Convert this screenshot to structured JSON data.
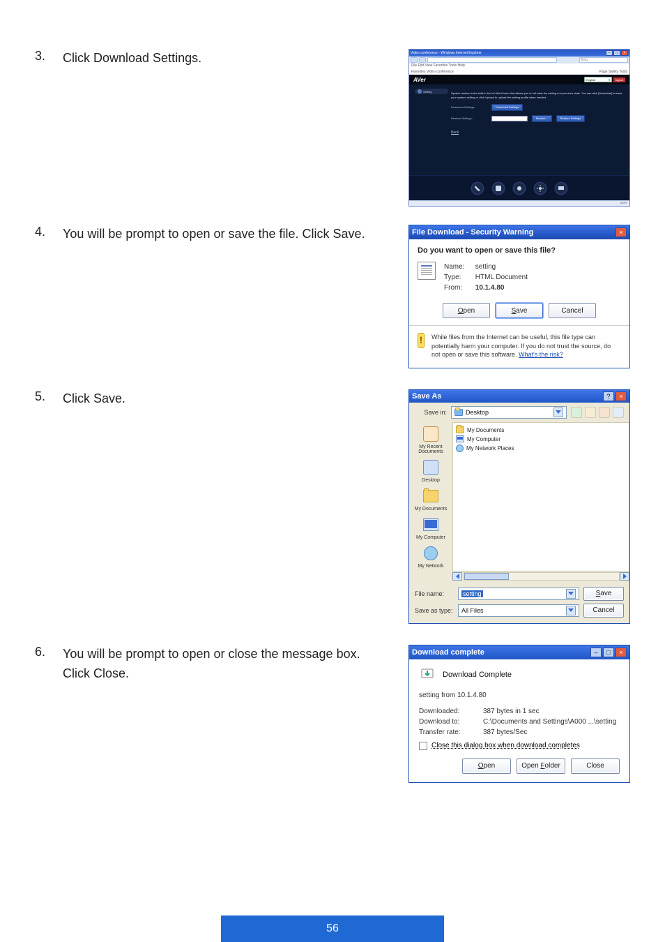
{
  "page_number": "56",
  "steps": {
    "s3": {
      "num": "3.",
      "text": "Click Download Settings."
    },
    "s4": {
      "num": "4.",
      "text": "You will be prompt to open or save the file. Click Save."
    },
    "s5": {
      "num": "5.",
      "text": "Click Save."
    },
    "s6": {
      "num": "6.",
      "text": "You will be prompt to open or close the message box. Click Close."
    }
  },
  "shot1": {
    "window_title": "Video conference - Windows Internet Explorer",
    "address": "10.1.4.80",
    "search_placeholder": "Bing",
    "menu": "File  Edit  View  Favorites  Tools  Help",
    "fav_left": "Favorites   Video conference",
    "fav_right": "Page  Safety  Tools",
    "brand": "AVer",
    "lang": "English",
    "logout": "logout",
    "side_item": "Setting",
    "desc": "System restore is the built-in tool of AVerComm that allows you to roll back the setting to a previous state. You can click [Download] to save your system setting or click Upload to upload the setting profile when needed.",
    "row1_label": "Download Settings:",
    "row1_btn": "Download Settings",
    "row2_label": "Restore Settings:",
    "row2_btn1": "Browse...",
    "row2_btn2": "Restore Settings",
    "back": "Back",
    "status_zoom": "100%"
  },
  "shot2": {
    "title": "File Download - Security Warning",
    "question": "Do you want to open or save this file?",
    "name_k": "Name:",
    "name_v": "setting",
    "type_k": "Type:",
    "type_v": "HTML Document",
    "from_k": "From:",
    "from_v": "10.1.4.80",
    "btn_open": "Open",
    "btn_save": "Save",
    "btn_cancel": "Cancel",
    "warn": "While files from the Internet can be useful, this file type can potentially harm your computer. If you do not trust the source, do not open or save this software. ",
    "warn_link": "What's the risk?"
  },
  "shot3": {
    "title": "Save As",
    "savein_label": "Save in:",
    "savein_value": "Desktop",
    "places": {
      "recent": "My Recent Documents",
      "desktop": "Desktop",
      "docs": "My Documents",
      "comp": "My Computer",
      "net": "My Network"
    },
    "list": {
      "i1": "My Documents",
      "i2": "My Computer",
      "i3": "My Network Places"
    },
    "filename_label": "File name:",
    "filename_value": "setting",
    "type_label": "Save as type:",
    "type_value": "All Files",
    "btn_save": "Save",
    "btn_cancel": "Cancel"
  },
  "shot4": {
    "title": "Download complete",
    "heading": "Download Complete",
    "file_line": "setting from 10.1.4.80",
    "k1": "Downloaded:",
    "v1": "387 bytes in 1 sec",
    "k2": "Download to:",
    "v2": "C:\\Documents and Settings\\A000 ...\\setting",
    "k3": "Transfer rate:",
    "v3": "387 bytes/Sec",
    "chk_label": "Close this dialog box when download completes",
    "btn_open": "Open",
    "btn_folder": "Open Folder",
    "btn_close": "Close"
  }
}
